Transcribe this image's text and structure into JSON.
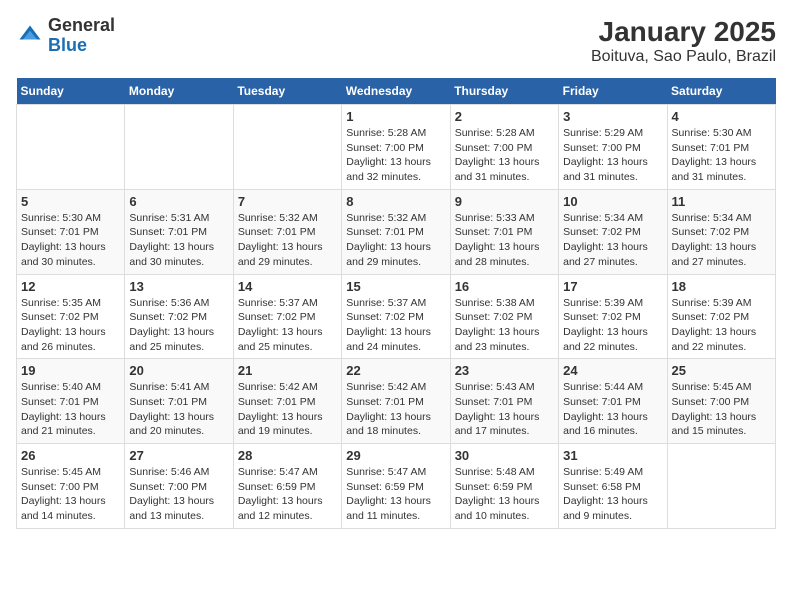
{
  "logo": {
    "general": "General",
    "blue": "Blue"
  },
  "title": "January 2025",
  "subtitle": "Boituva, Sao Paulo, Brazil",
  "days_of_week": [
    "Sunday",
    "Monday",
    "Tuesday",
    "Wednesday",
    "Thursday",
    "Friday",
    "Saturday"
  ],
  "weeks": [
    [
      {
        "day": null
      },
      {
        "day": null
      },
      {
        "day": null
      },
      {
        "day": "1",
        "sunrise": "5:28 AM",
        "sunset": "7:00 PM",
        "daylight": "13 hours and 32 minutes."
      },
      {
        "day": "2",
        "sunrise": "5:28 AM",
        "sunset": "7:00 PM",
        "daylight": "13 hours and 31 minutes."
      },
      {
        "day": "3",
        "sunrise": "5:29 AM",
        "sunset": "7:00 PM",
        "daylight": "13 hours and 31 minutes."
      },
      {
        "day": "4",
        "sunrise": "5:30 AM",
        "sunset": "7:01 PM",
        "daylight": "13 hours and 31 minutes."
      }
    ],
    [
      {
        "day": "5",
        "sunrise": "5:30 AM",
        "sunset": "7:01 PM",
        "daylight": "13 hours and 30 minutes."
      },
      {
        "day": "6",
        "sunrise": "5:31 AM",
        "sunset": "7:01 PM",
        "daylight": "13 hours and 30 minutes."
      },
      {
        "day": "7",
        "sunrise": "5:32 AM",
        "sunset": "7:01 PM",
        "daylight": "13 hours and 29 minutes."
      },
      {
        "day": "8",
        "sunrise": "5:32 AM",
        "sunset": "7:01 PM",
        "daylight": "13 hours and 29 minutes."
      },
      {
        "day": "9",
        "sunrise": "5:33 AM",
        "sunset": "7:01 PM",
        "daylight": "13 hours and 28 minutes."
      },
      {
        "day": "10",
        "sunrise": "5:34 AM",
        "sunset": "7:02 PM",
        "daylight": "13 hours and 27 minutes."
      },
      {
        "day": "11",
        "sunrise": "5:34 AM",
        "sunset": "7:02 PM",
        "daylight": "13 hours and 27 minutes."
      }
    ],
    [
      {
        "day": "12",
        "sunrise": "5:35 AM",
        "sunset": "7:02 PM",
        "daylight": "13 hours and 26 minutes."
      },
      {
        "day": "13",
        "sunrise": "5:36 AM",
        "sunset": "7:02 PM",
        "daylight": "13 hours and 25 minutes."
      },
      {
        "day": "14",
        "sunrise": "5:37 AM",
        "sunset": "7:02 PM",
        "daylight": "13 hours and 25 minutes."
      },
      {
        "day": "15",
        "sunrise": "5:37 AM",
        "sunset": "7:02 PM",
        "daylight": "13 hours and 24 minutes."
      },
      {
        "day": "16",
        "sunrise": "5:38 AM",
        "sunset": "7:02 PM",
        "daylight": "13 hours and 23 minutes."
      },
      {
        "day": "17",
        "sunrise": "5:39 AM",
        "sunset": "7:02 PM",
        "daylight": "13 hours and 22 minutes."
      },
      {
        "day": "18",
        "sunrise": "5:39 AM",
        "sunset": "7:02 PM",
        "daylight": "13 hours and 22 minutes."
      }
    ],
    [
      {
        "day": "19",
        "sunrise": "5:40 AM",
        "sunset": "7:01 PM",
        "daylight": "13 hours and 21 minutes."
      },
      {
        "day": "20",
        "sunrise": "5:41 AM",
        "sunset": "7:01 PM",
        "daylight": "13 hours and 20 minutes."
      },
      {
        "day": "21",
        "sunrise": "5:42 AM",
        "sunset": "7:01 PM",
        "daylight": "13 hours and 19 minutes."
      },
      {
        "day": "22",
        "sunrise": "5:42 AM",
        "sunset": "7:01 PM",
        "daylight": "13 hours and 18 minutes."
      },
      {
        "day": "23",
        "sunrise": "5:43 AM",
        "sunset": "7:01 PM",
        "daylight": "13 hours and 17 minutes."
      },
      {
        "day": "24",
        "sunrise": "5:44 AM",
        "sunset": "7:01 PM",
        "daylight": "13 hours and 16 minutes."
      },
      {
        "day": "25",
        "sunrise": "5:45 AM",
        "sunset": "7:00 PM",
        "daylight": "13 hours and 15 minutes."
      }
    ],
    [
      {
        "day": "26",
        "sunrise": "5:45 AM",
        "sunset": "7:00 PM",
        "daylight": "13 hours and 14 minutes."
      },
      {
        "day": "27",
        "sunrise": "5:46 AM",
        "sunset": "7:00 PM",
        "daylight": "13 hours and 13 minutes."
      },
      {
        "day": "28",
        "sunrise": "5:47 AM",
        "sunset": "6:59 PM",
        "daylight": "13 hours and 12 minutes."
      },
      {
        "day": "29",
        "sunrise": "5:47 AM",
        "sunset": "6:59 PM",
        "daylight": "13 hours and 11 minutes."
      },
      {
        "day": "30",
        "sunrise": "5:48 AM",
        "sunset": "6:59 PM",
        "daylight": "13 hours and 10 minutes."
      },
      {
        "day": "31",
        "sunrise": "5:49 AM",
        "sunset": "6:58 PM",
        "daylight": "13 hours and 9 minutes."
      },
      {
        "day": null
      }
    ]
  ]
}
